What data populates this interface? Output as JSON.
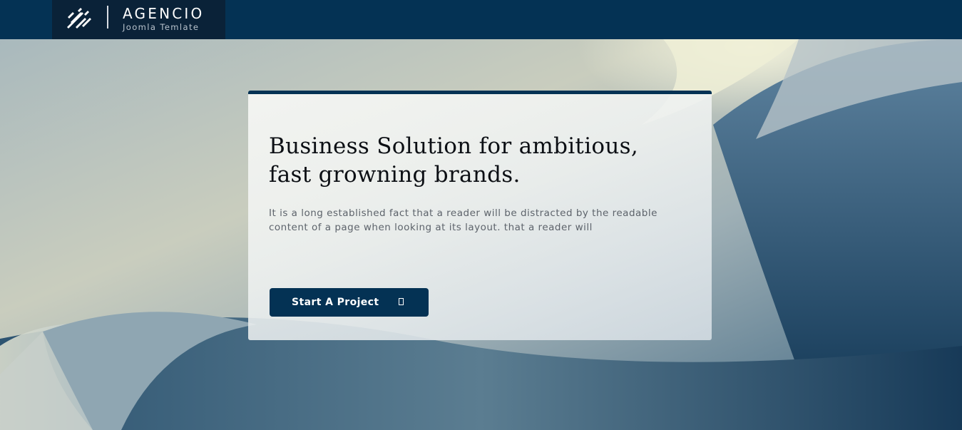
{
  "header": {
    "brand_name": "AGENCIO",
    "brand_tagline": "Joomla Temlate",
    "background_color": "#043254",
    "logo_block_color": "#0a2238",
    "logo_icon": "logo-mark-icon"
  },
  "hero": {
    "title_line1": "Business Solution for ambitious,",
    "title_line2": "fast growning brands.",
    "description_line1": "It is a long established fact that a reader will be distracted by the readable",
    "description_line2": "content of a page when looking at its layout. that a reader will",
    "cta_label": "Start A Project",
    "cta_icon": "square-glyph-icon",
    "accent_color": "#043254"
  }
}
